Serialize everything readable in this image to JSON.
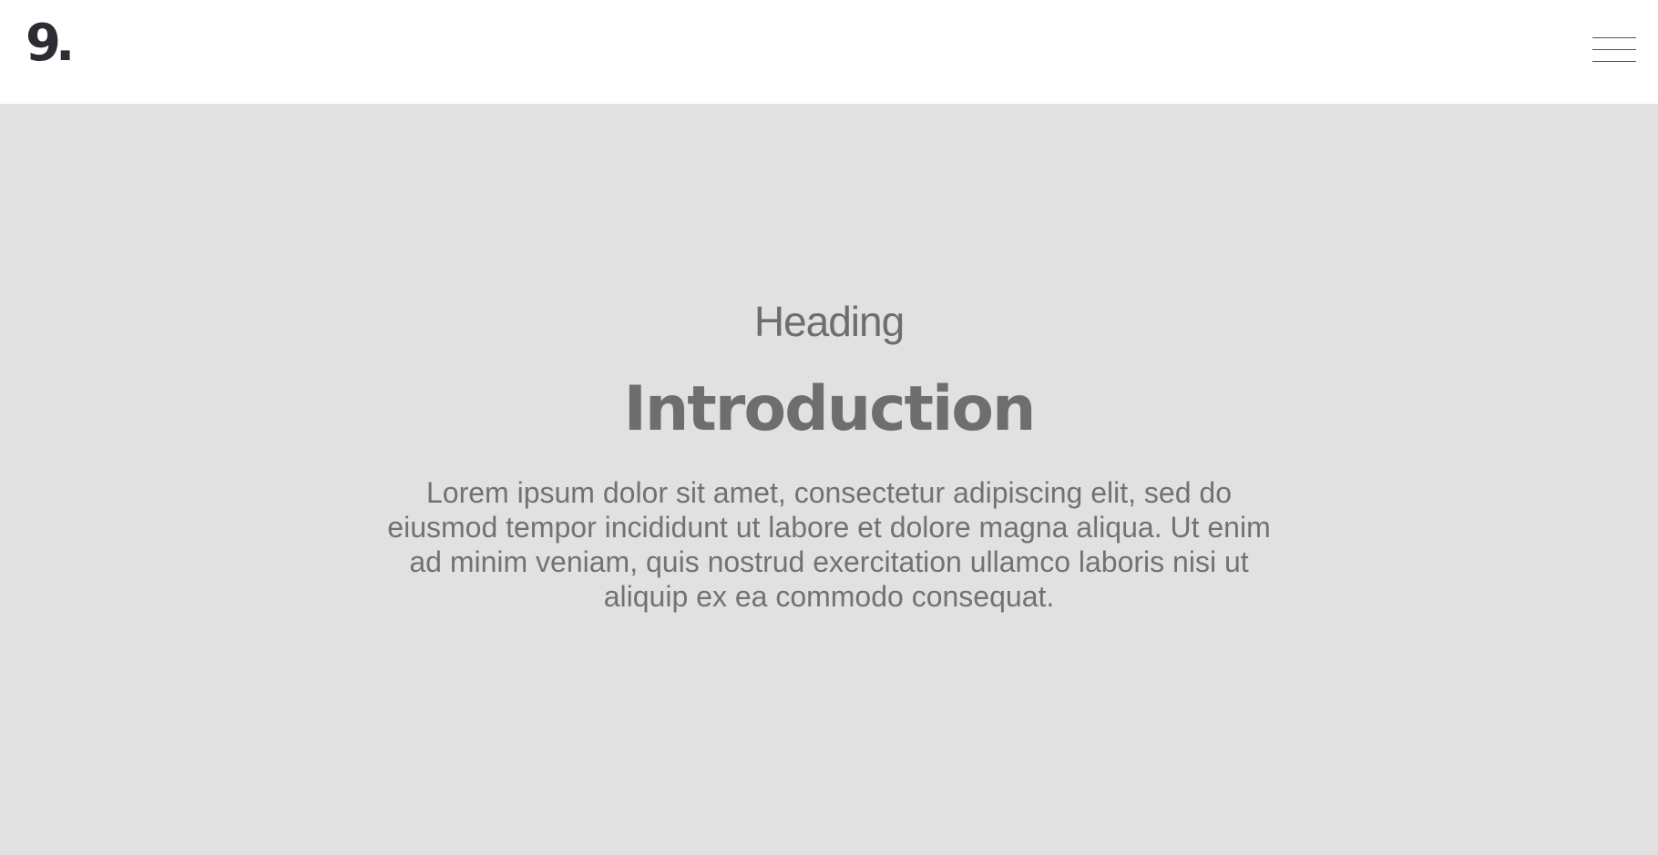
{
  "header": {
    "logo_text": "9.",
    "menu_icon": "hamburger-menu-icon"
  },
  "hero": {
    "subheading": "Heading",
    "title": "Introduction",
    "body": "Lorem ipsum dolor sit amet, consectetur adipiscing elit, sed do eiusmod tempor incididunt ut labore et dolore magna aliqua. Ut enim ad minim veniam, quis nostrud exercitation ullamco laboris nisi ut aliquip ex ea commodo consequat."
  },
  "colors": {
    "header_background": "#ffffff",
    "hero_background": "#e1e1e1",
    "logo": "#2b2d33",
    "text": "#6e6e6e"
  }
}
